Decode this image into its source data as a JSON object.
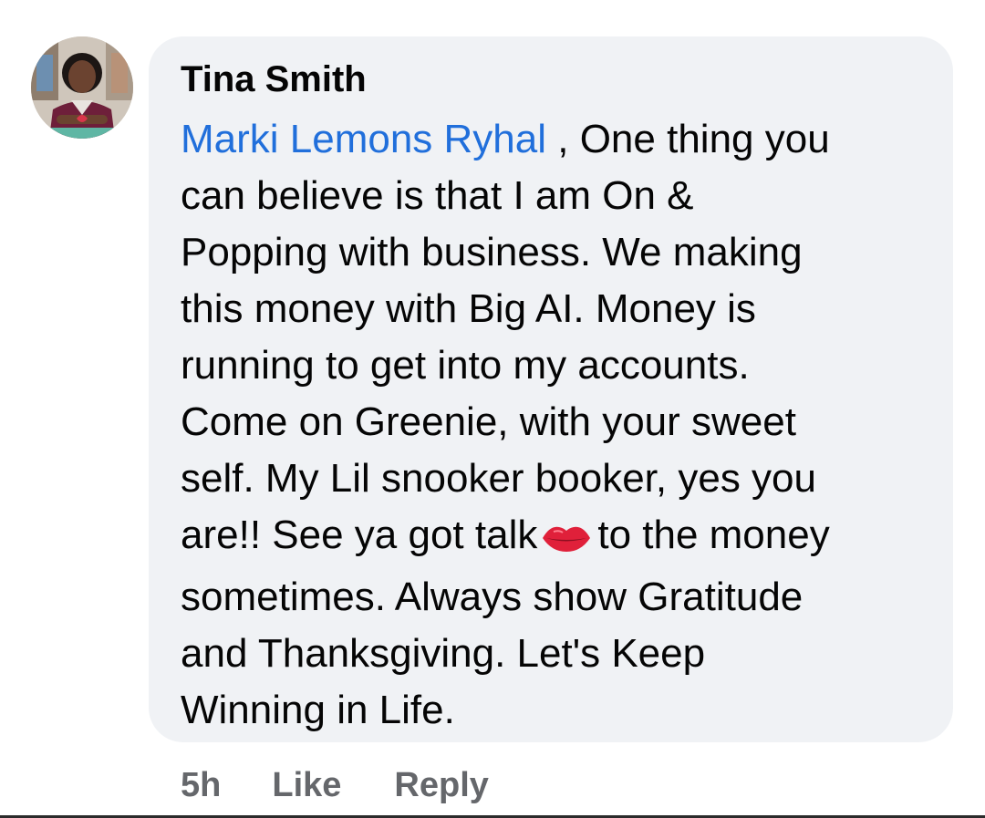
{
  "comment": {
    "author": "Tina Smith",
    "mention": "Marki Lemons Ryhal",
    "lines": [
      " , One thing you",
      "can believe is that I am On &",
      "Popping with business. We making",
      "this money with Big AI. Money is",
      "running to get into my accounts.",
      "Come on Greenie, with your sweet",
      "self. My Lil snooker booker, yes you"
    ],
    "line8_before_emoji": "are!! See ya got talk",
    "emoji": "lips-emoji",
    "line8_after_emoji": "to the money",
    "tail_lines": [
      "sometimes. Always show Gratitude",
      "and Thanksgiving. Let's Keep",
      "Winning in Life."
    ]
  },
  "actions": {
    "timestamp": "5h",
    "like_label": "Like",
    "reply_label": "Reply"
  },
  "colors": {
    "bubble_bg": "#f0f2f5",
    "mention": "#216fdb",
    "action_text": "#65676b",
    "body_text": "#050505"
  }
}
